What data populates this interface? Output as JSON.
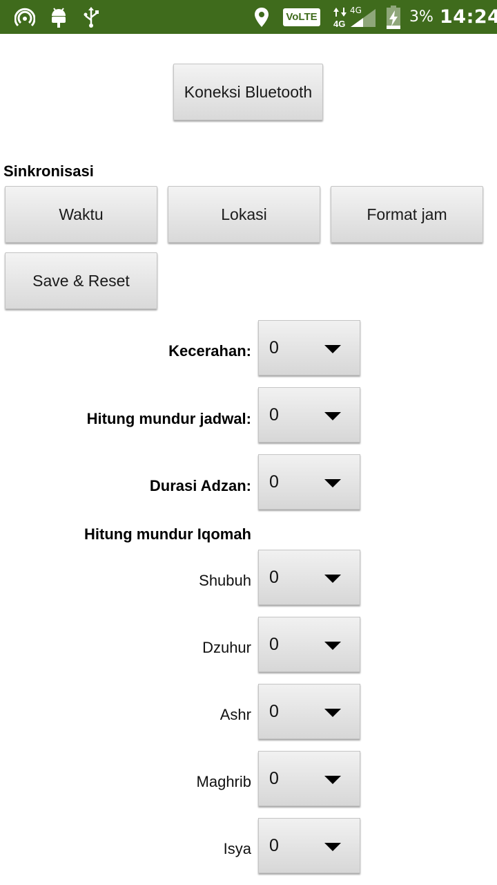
{
  "status_bar": {
    "battery_percent": "3%",
    "time": "14:24",
    "network_type": "4G",
    "volte_label": "VoLTE",
    "icons_left": [
      "hotspot-icon",
      "android-icon",
      "usb-icon"
    ],
    "icons_right": [
      "location-icon",
      "volte-icon",
      "data-arrows-icon",
      "signal-icon",
      "battery-charging-icon"
    ],
    "background_color": "#3f6b1c"
  },
  "bluetooth_button": {
    "label": "Koneksi Bluetooth"
  },
  "sync": {
    "title": "Sinkronisasi",
    "buttons": [
      "Waktu",
      "Lokasi",
      "Format jam",
      "Save & Reset"
    ]
  },
  "settings": [
    {
      "label": "Kecerahan:",
      "value": "0"
    },
    {
      "label": "Hitung mundur jadwal:",
      "value": "0"
    },
    {
      "label": "Durasi Adzan:",
      "value": "0"
    }
  ],
  "iqomah": {
    "title": "Hitung mundur Iqomah",
    "rows": [
      {
        "label": "Shubuh",
        "value": "0"
      },
      {
        "label": "Dzuhur",
        "value": "0"
      },
      {
        "label": "Ashr",
        "value": "0"
      },
      {
        "label": "Maghrib",
        "value": "0"
      },
      {
        "label": "Isya",
        "value": "0"
      }
    ]
  }
}
